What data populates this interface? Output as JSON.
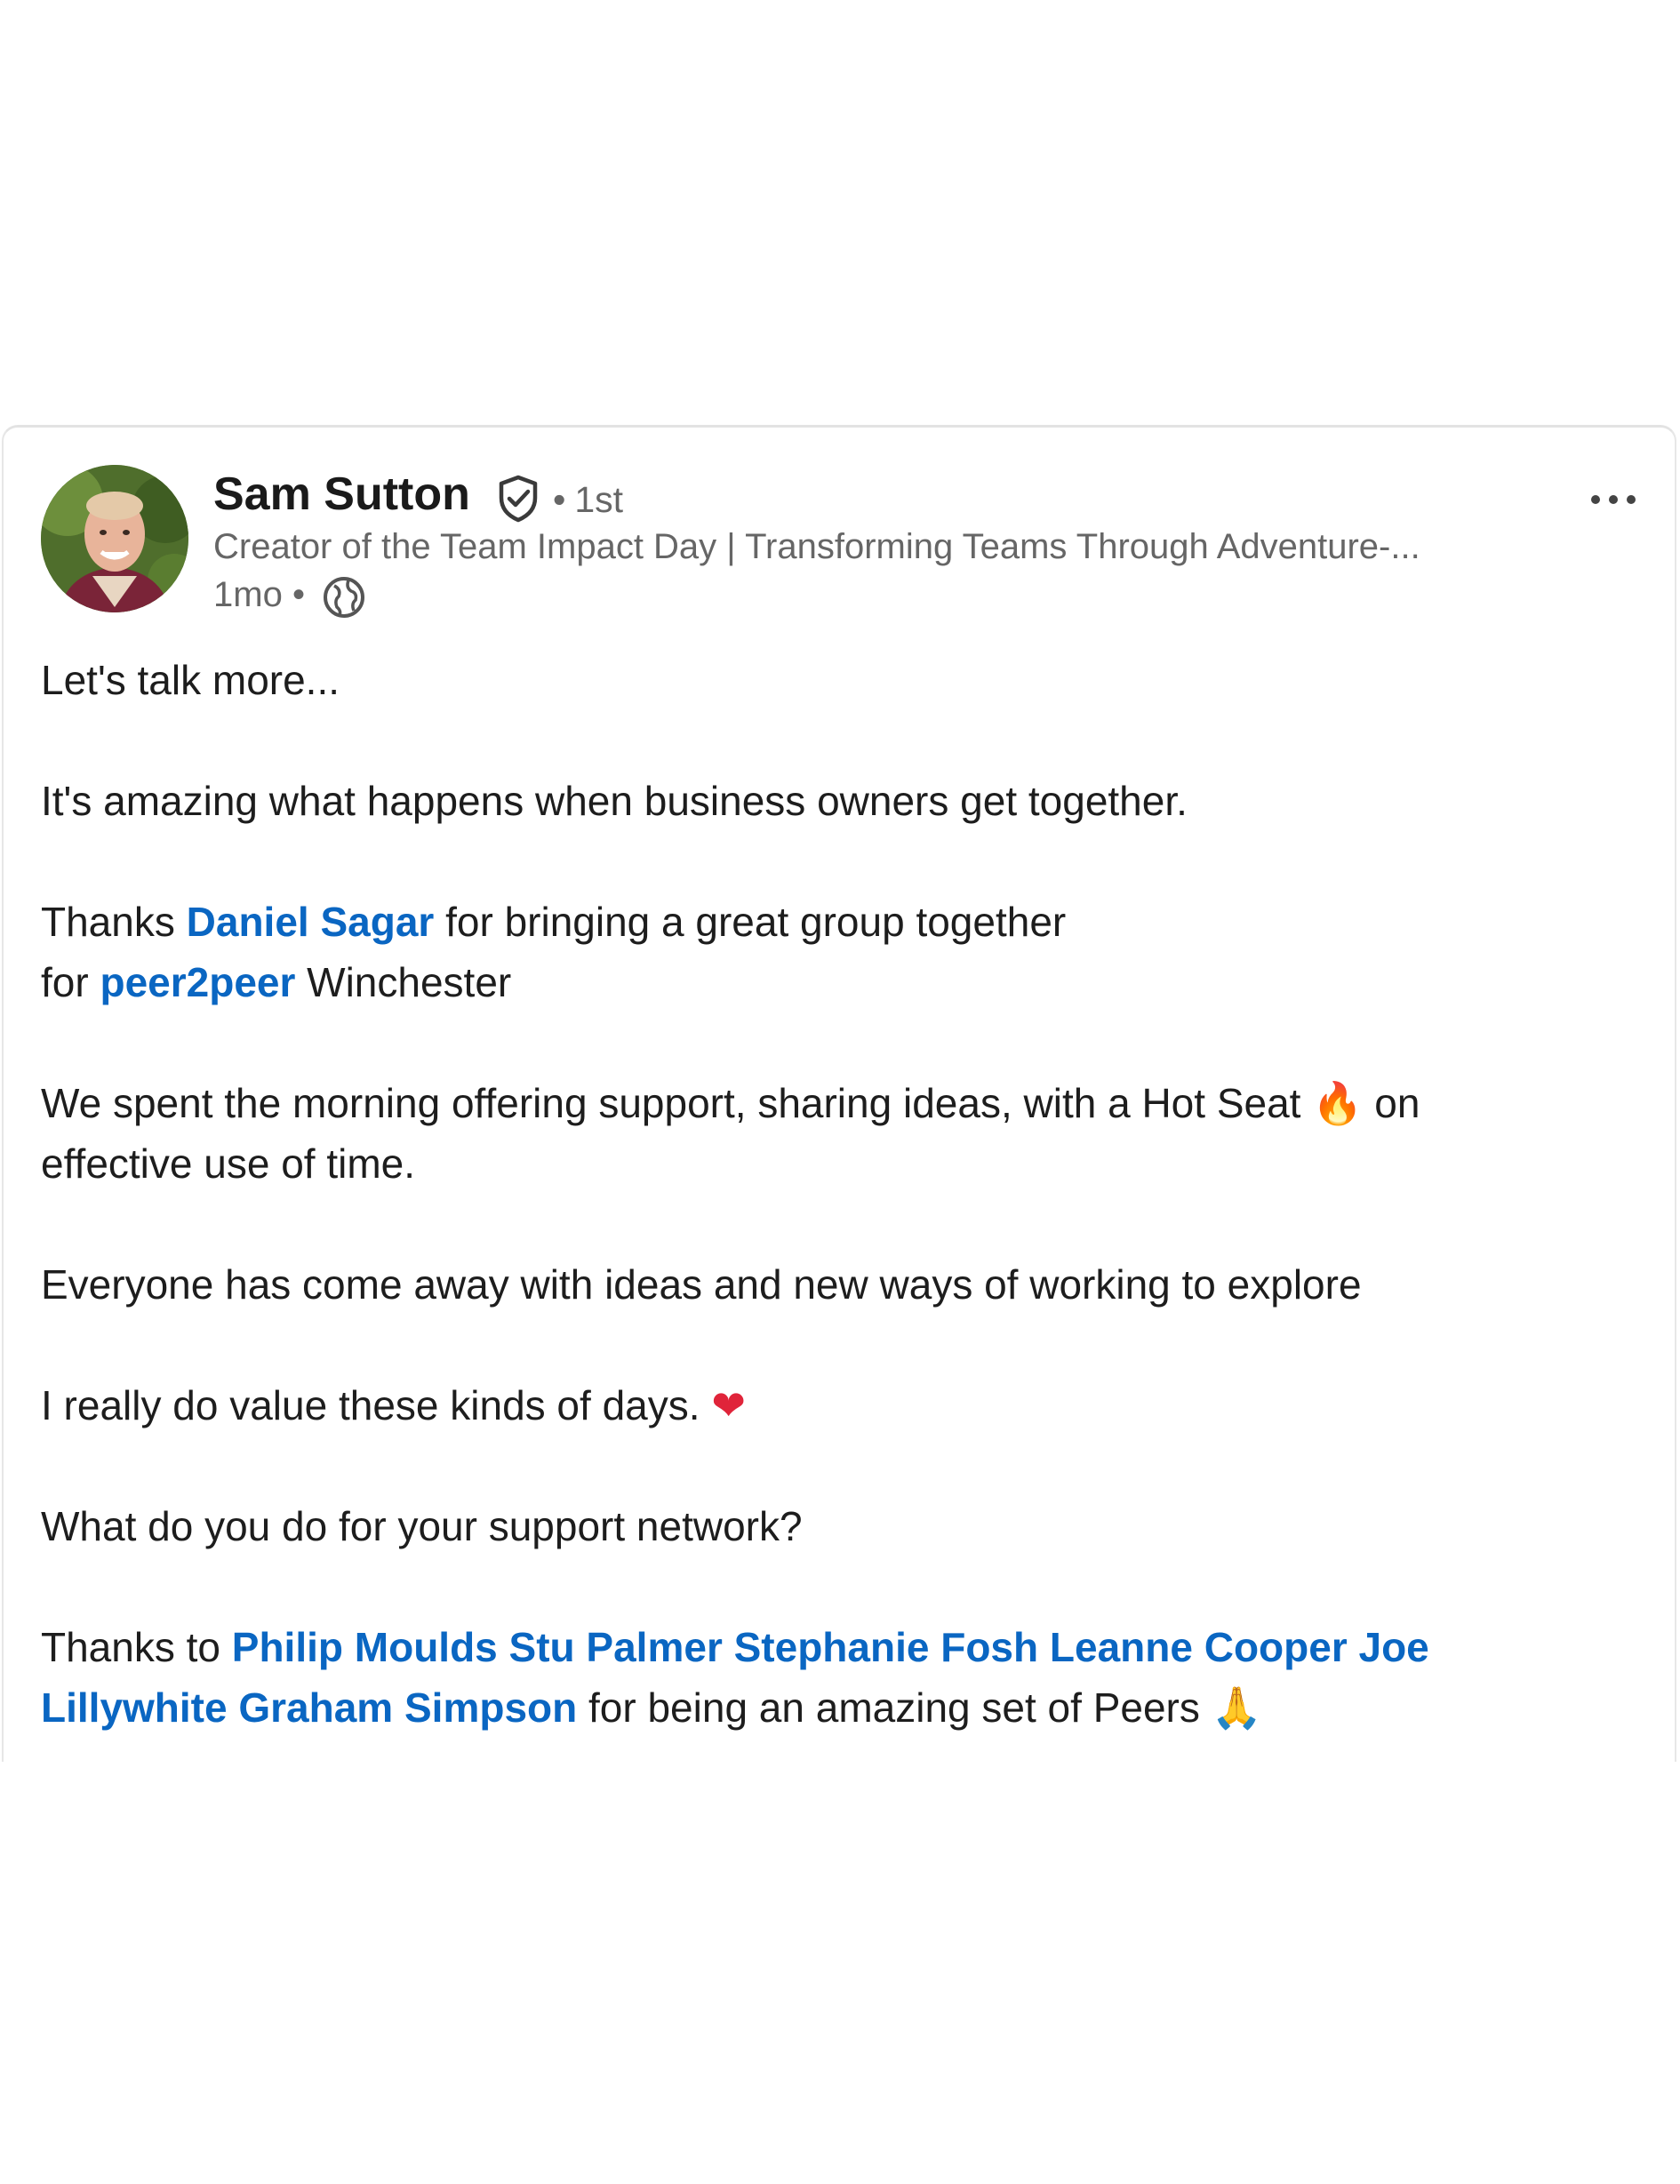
{
  "post": {
    "author": {
      "name": "Sam Sutton",
      "degree_separator": "•",
      "degree": "1st",
      "headline": "Creator of the Team Impact Day | Transforming Teams Through Adventure-...",
      "time_ago": "1mo",
      "meta_separator": "•",
      "visibility_icon": "globe-icon",
      "verified_icon": "shield-check-icon",
      "avatar_icon": "profile-photo"
    },
    "more_menu_icon": "ellipsis-icon",
    "body": {
      "p1": "Let's talk more...",
      "p2": "It's amazing what happens when business owners get together.",
      "p3_a": "Thanks ",
      "p3_mention": "Daniel Sagar",
      "p3_b": " for bringing a great group together",
      "p3_c": "for ",
      "p3_mention2": "peer2peer",
      "p3_d": " Winchester",
      "p4_a": "We spent the morning offering support, sharing ideas, with a Hot Seat ",
      "p4_emoji": "🔥",
      "p4_b": " on effective use of time.",
      "p5": "Everyone has come away with ideas and new ways of working to explore",
      "p6_a": "I really do value these kinds of days. ",
      "p6_emoji": "❤",
      "p7": "What do you do for your support network?",
      "p8_a": "Thanks to ",
      "p8_mentions": "Philip Moulds Stu Palmer Stephanie Fosh Leanne Cooper Joe Lillywhite Graham Simpson",
      "p8_b": " for being an amazing set of Peers ",
      "p8_emoji": "🙏"
    },
    "colors": {
      "link": "#0a66c2",
      "text": "#1d1d1d",
      "secondary_text": "#666666"
    }
  }
}
